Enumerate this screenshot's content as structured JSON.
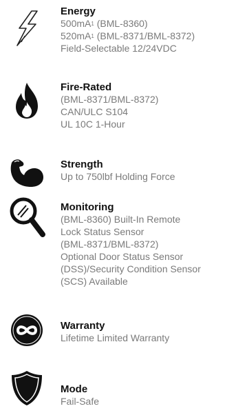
{
  "features": [
    {
      "icon": "lightning-bolt-icon",
      "title": "Energy",
      "lines": [
        {
          "main": "500mA",
          "sup": "1",
          "rest": " (BML-8360)"
        },
        {
          "main": "520mA",
          "sup": "1",
          "rest": " (BML-8371/BML-8372)"
        },
        {
          "main": "Field-Selectable 12/24VDC",
          "sup": "",
          "rest": ""
        }
      ]
    },
    {
      "icon": "flame-icon",
      "title": "Fire-Rated",
      "lines": [
        "(BML-8371/BML-8372)",
        "CAN/ULC S104",
        "UL 10C 1-Hour"
      ]
    },
    {
      "icon": "flexed-arm-icon",
      "title": "Strength",
      "lines": [
        "Up to 750lbf Holding Force"
      ]
    },
    {
      "icon": "magnifying-glass-icon",
      "title": "Monitoring",
      "lines": [
        "(BML-8360) Built-In Remote",
        "Lock Status Sensor",
        "(BML-8371/BML-8372)",
        "Optional Door Status Sensor",
        "(DSS)/Security Condition Sensor",
        "(SCS) Available"
      ]
    },
    {
      "icon": "infinity-icon",
      "title": "Warranty",
      "lines": [
        "Lifetime Limited Warranty"
      ]
    },
    {
      "icon": "shield-icon",
      "title": "Mode",
      "lines": [
        "Fail-Safe"
      ]
    }
  ]
}
